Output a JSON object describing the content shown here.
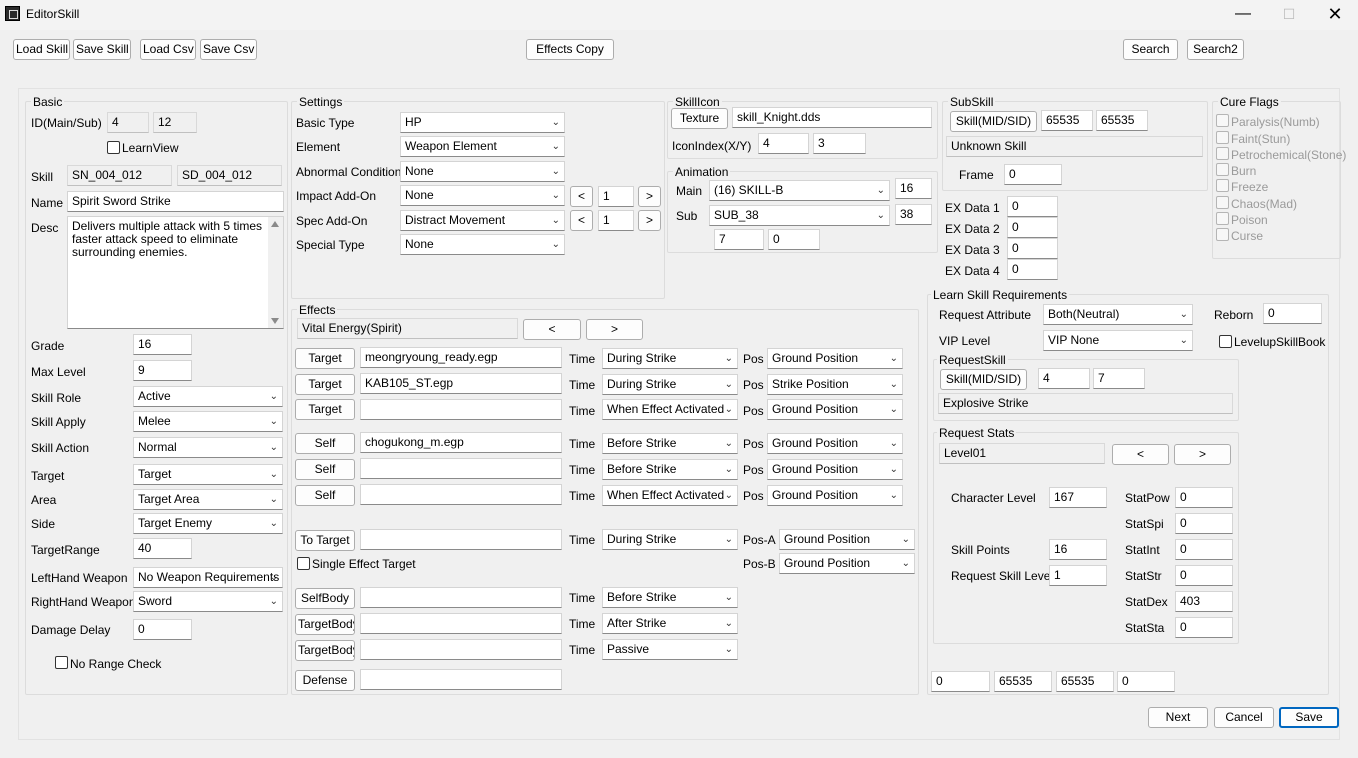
{
  "window": {
    "title": "EditorSkill"
  },
  "toolbar": {
    "load_skill": "Load Skill",
    "save_skill": "Save Skill",
    "load_csv": "Load Csv",
    "save_csv": "Save Csv",
    "effects_copy": "Effects Copy",
    "search": "Search",
    "search2": "Search2"
  },
  "basic": {
    "title": "Basic",
    "id_label": "ID(Main/Sub)",
    "id_main": "4",
    "id_sub": "12",
    "learnview_label": "LearnView",
    "skill_label": "Skill",
    "skill_sn": "SN_004_012",
    "skill_sd": "SD_004_012",
    "name_label": "Name",
    "name_value": "Spirit Sword Strike",
    "desc_label": "Desc",
    "desc_value": "Delivers multiple attack with 5 times faster attack speed to eliminate surrounding enemies.",
    "grade_label": "Grade",
    "grade_value": "16",
    "maxlevel_label": "Max Level",
    "maxlevel_value": "9",
    "role_label": "Skill Role",
    "role_value": "Active",
    "apply_label": "Skill Apply",
    "apply_value": "Melee",
    "action_label": "Skill Action",
    "action_value": "Normal",
    "target_label": "Target",
    "target_value": "Target",
    "area_label": "Area",
    "area_value": "Target Area",
    "side_label": "Side",
    "side_value": "Target Enemy",
    "range_label": "TargetRange",
    "range_value": "40",
    "lefthand_label": "LeftHand Weapon",
    "lefthand_value": "No Weapon Requirements",
    "righthand_label": "RightHand Weapon",
    "righthand_value": "Sword",
    "delay_label": "Damage Delay",
    "delay_value": "0",
    "norange_label": "No Range Check"
  },
  "settings": {
    "title": "Settings",
    "basic_type_label": "Basic Type",
    "basic_type_value": "HP",
    "element_label": "Element",
    "element_value": "Weapon Element",
    "abnormal_label": "Abnormal Condition",
    "abnormal_value": "None",
    "impact_label": "Impact Add-On",
    "impact_value": "None",
    "impact_num": "1",
    "spec_label": "Spec Add-On",
    "spec_value": "Distract Movement",
    "spec_num": "1",
    "special_label": "Special Type",
    "special_value": "None",
    "prev": "<",
    "next": ">"
  },
  "skillicon": {
    "title": "SkillIcon",
    "texture_btn": "Texture",
    "texture_value": "skill_Knight.dds",
    "iconindex_label": "IconIndex(X/Y)",
    "icon_x": "4",
    "icon_y": "3"
  },
  "animation": {
    "title": "Animation",
    "main_label": "Main",
    "main_value": "(16) SKILL-B",
    "main_num": "16",
    "sub_label": "Sub",
    "sub_value": "SUB_38",
    "sub_num": "38",
    "extra1": "7",
    "extra2": "0"
  },
  "subskill": {
    "title": "SubSkill",
    "btn": "Skill(MID/SID)",
    "mid": "65535",
    "sid": "65535",
    "name": "Unknown Skill",
    "frame_label": "Frame",
    "frame_value": "0"
  },
  "exdata": [
    {
      "label": "EX Data 1",
      "value": "0"
    },
    {
      "label": "EX Data 2",
      "value": "0"
    },
    {
      "label": "EX Data 3",
      "value": "0"
    },
    {
      "label": "EX Data 4",
      "value": "0"
    }
  ],
  "cureflags": {
    "title": "Cure Flags",
    "items": [
      "Paralysis(Numb)",
      "Faint(Stun)",
      "Petrochemical(Stone)",
      "Burn",
      "Freeze",
      "Chaos(Mad)",
      "Poison",
      "Curse"
    ]
  },
  "effects": {
    "title": "Effects",
    "header_value": "Vital Energy(Spirit)",
    "prev": "<",
    "next": ">",
    "time_label": "Time",
    "pos_label": "Pos",
    "rows": [
      {
        "btn": "Target",
        "file": "meongryoung_ready.egp",
        "time": "During Strike",
        "pos": "Ground Position"
      },
      {
        "btn": "Target",
        "file": "KAB105_ST.egp",
        "time": "During Strike",
        "pos": "Strike Position"
      },
      {
        "btn": "Target",
        "file": "",
        "time": "When Effect Activated",
        "pos": "Ground Position"
      },
      {
        "btn": "Self",
        "file": "chogukong_m.egp",
        "time": "Before Strike",
        "pos": "Ground Position"
      },
      {
        "btn": "Self",
        "file": "",
        "time": "Before Strike",
        "pos": "Ground Position"
      },
      {
        "btn": "Self",
        "file": "",
        "time": "When Effect Activated",
        "pos": "Ground Position"
      }
    ],
    "totarget": {
      "btn": "To Target",
      "file": "",
      "time": "During Strike",
      "posa_label": "Pos-A",
      "posa": "Ground Position",
      "posb_label": "Pos-B",
      "posb": "Ground Position"
    },
    "single_label": "Single Effect Target",
    "body_rows": [
      {
        "btn": "SelfBody",
        "file": "",
        "time": "Before Strike"
      },
      {
        "btn": "TargetBody",
        "file": "",
        "time": "After Strike"
      },
      {
        "btn": "TargetBody",
        "file": "",
        "time": "Passive"
      }
    ],
    "defense_btn": "Defense",
    "defense_file": ""
  },
  "learn": {
    "title": "Learn Skill Requirements",
    "attr_label": "Request Attribute",
    "attr_value": "Both(Neutral)",
    "reborn_label": "Reborn",
    "reborn_value": "0",
    "vip_label": "VIP Level",
    "vip_value": "VIP None",
    "levelup_label": "LevelupSkillBook",
    "reqskill_title": "RequestSkill",
    "reqskill_btn": "Skill(MID/SID)",
    "req_mid": "4",
    "req_sid": "7",
    "reqskill_name": "Explosive Strike",
    "reqstats_title": "Request Stats",
    "level_value": "Level01",
    "prev": "<",
    "next": ">",
    "charlevel_label": "Character Level",
    "charlevel_value": "167",
    "skillpoints_label": "Skill Points",
    "skillpoints_value": "16",
    "reqskilllevel_label": "Request Skill Level",
    "reqskilllevel_value": "1",
    "stats": [
      {
        "label": "StatPow",
        "value": "0"
      },
      {
        "label": "StatSpi",
        "value": "0"
      },
      {
        "label": "StatInt",
        "value": "0"
      },
      {
        "label": "StatStr",
        "value": "0"
      },
      {
        "label": "StatDex",
        "value": "403"
      },
      {
        "label": "StatSta",
        "value": "0"
      }
    ],
    "bottom": [
      "0",
      "65535",
      "65535",
      "0"
    ]
  },
  "footer": {
    "next": "Next",
    "cancel": "Cancel",
    "save": "Save"
  }
}
